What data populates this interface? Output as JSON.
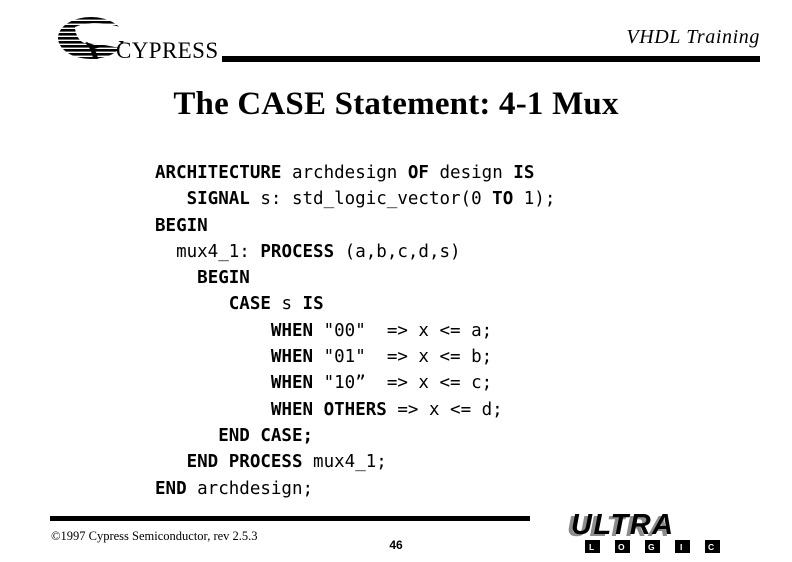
{
  "slide": {
    "page_number": "46",
    "background_color": "#ffffff",
    "text_color": "#000000"
  },
  "header": {
    "course_title": "VHDL Training",
    "logo": {
      "name": "cypress-logo",
      "wordmark": "CYPRESS",
      "mark": "striped-globe-hand-icon"
    },
    "rule": "header-divider-rule"
  },
  "title": {
    "text": "The CASE Statement: 4-1 Mux"
  },
  "code": {
    "language": "VHDL",
    "lines": [
      {
        "indent": 0,
        "tokens": [
          {
            "t": "ARCHITECTURE",
            "kw": true
          },
          {
            "t": " ",
            "kw": false
          },
          {
            "t": "archdesign",
            "kw": false
          },
          {
            "t": " ",
            "kw": false
          },
          {
            "t": "OF",
            "kw": true
          },
          {
            "t": " ",
            "kw": false
          },
          {
            "t": "design",
            "kw": false
          },
          {
            "t": " ",
            "kw": false
          },
          {
            "t": "IS",
            "kw": true
          }
        ]
      },
      {
        "indent": 3,
        "tokens": [
          {
            "t": "SIGNAL",
            "kw": true
          },
          {
            "t": " s: std_logic_vector(0 ",
            "kw": false
          },
          {
            "t": "TO",
            "kw": true
          },
          {
            "t": " 1);",
            "kw": false
          }
        ]
      },
      {
        "indent": 0,
        "tokens": [
          {
            "t": "BEGIN",
            "kw": true
          }
        ]
      },
      {
        "indent": 2,
        "tokens": [
          {
            "t": "mux4_1: ",
            "kw": false
          },
          {
            "t": "PROCESS",
            "kw": true
          },
          {
            "t": " (a,b,c,d,s)",
            "kw": false
          }
        ]
      },
      {
        "indent": 4,
        "tokens": [
          {
            "t": "BEGIN",
            "kw": true
          }
        ]
      },
      {
        "indent": 7,
        "tokens": [
          {
            "t": "CASE",
            "kw": true
          },
          {
            "t": " s ",
            "kw": false
          },
          {
            "t": "IS",
            "kw": true
          }
        ]
      },
      {
        "indent": 11,
        "tokens": [
          {
            "t": "WHEN",
            "kw": true
          },
          {
            "t": " \"00\"  => x <= a;",
            "kw": false
          }
        ]
      },
      {
        "indent": 11,
        "tokens": [
          {
            "t": "WHEN",
            "kw": true
          },
          {
            "t": " \"01\"  => x <= b;",
            "kw": false
          }
        ]
      },
      {
        "indent": 11,
        "tokens": [
          {
            "t": "WHEN",
            "kw": true
          },
          {
            "t": " \"10”  => x <= c;",
            "kw": false
          }
        ]
      },
      {
        "indent": 11,
        "tokens": [
          {
            "t": "WHEN OTHERS",
            "kw": true
          },
          {
            "t": " => x <= d;",
            "kw": false
          }
        ]
      },
      {
        "indent": 6,
        "tokens": [
          {
            "t": "END CASE;",
            "kw": true
          }
        ]
      },
      {
        "indent": 3,
        "tokens": [
          {
            "t": "END PROCESS",
            "kw": true
          },
          {
            "t": " mux4_1;",
            "kw": false
          }
        ]
      },
      {
        "indent": 0,
        "tokens": [
          {
            "t": "END",
            "kw": true
          },
          {
            "t": " archdesign;",
            "kw": false
          }
        ]
      }
    ]
  },
  "footer": {
    "copyright": "©1997 Cypress Semiconductor, rev 2.5.3",
    "rule": "footer-divider-rule",
    "brand_logo": {
      "name": "ultra-logic-logo",
      "wordmark": "ULTRA",
      "subword_letters": [
        "L",
        "O",
        "G",
        "I",
        "C"
      ],
      "colors": {
        "dark": "#000000",
        "gray": "#8c8c8c"
      }
    }
  }
}
